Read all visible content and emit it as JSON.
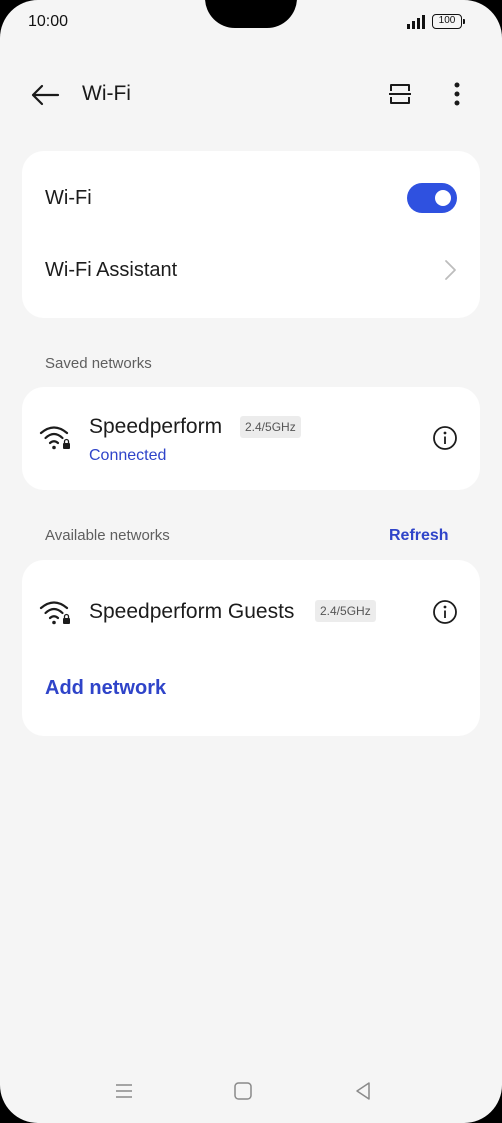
{
  "status_bar": {
    "time": "10:00",
    "battery": "100"
  },
  "app_bar": {
    "title": "Wi-Fi"
  },
  "wifi_card": {
    "wifi_label": "Wi-Fi",
    "wifi_enabled": true,
    "assistant_label": "Wi-Fi Assistant"
  },
  "saved_section": {
    "header": "Saved networks",
    "networks": [
      {
        "name": "Speedperform",
        "band": "2.4/5GHz",
        "status": "Connected"
      }
    ]
  },
  "available_section": {
    "header": "Available networks",
    "refresh_label": "Refresh",
    "networks": [
      {
        "name": "Speedperform Guests",
        "band": "2.4/5GHz"
      }
    ],
    "add_network_label": "Add network"
  },
  "colors": {
    "accent": "#2f51e0",
    "link": "#2f44c9",
    "background": "#f5f5f5",
    "card": "#ffffff"
  },
  "icons": [
    "back-arrow-icon",
    "scan-icon",
    "more-vert-icon",
    "wifi-locked-icon",
    "info-icon",
    "chevron-right-icon",
    "menu-icon",
    "home-icon",
    "back-triangle-icon"
  ]
}
